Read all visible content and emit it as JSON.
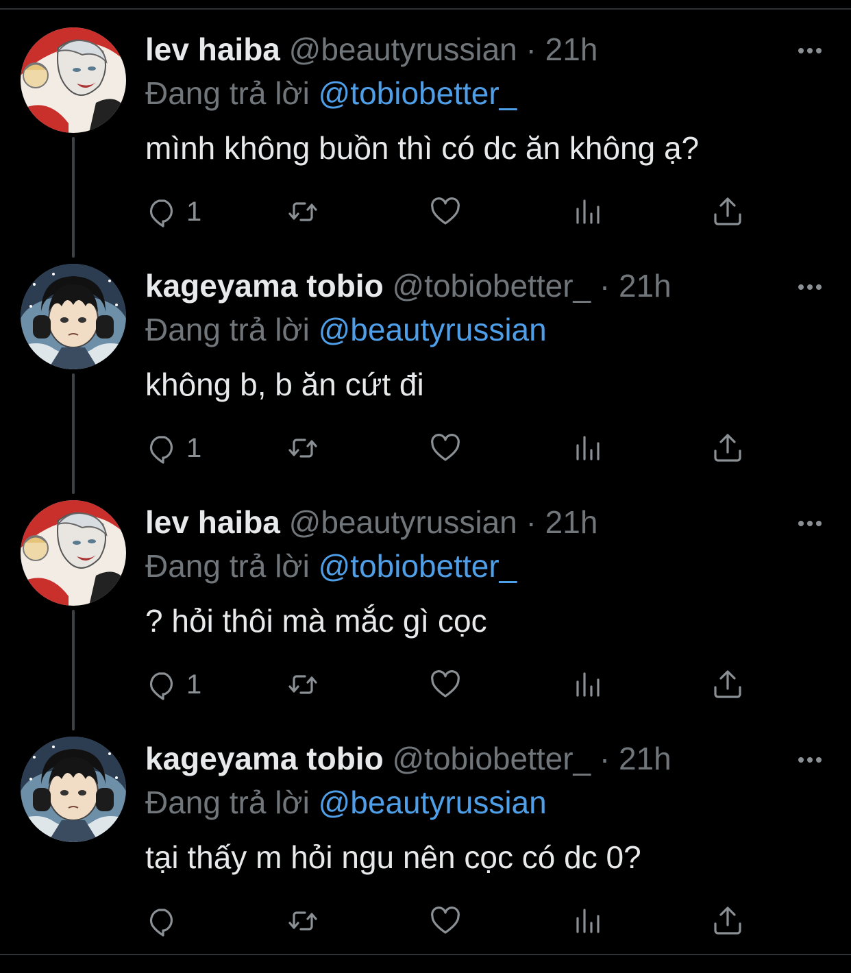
{
  "tweets": [
    {
      "display_name": "lev haiba",
      "handle": "@beautyrussian",
      "separator": "·",
      "time": "21h",
      "replying_prefix": "Đang trả lời",
      "replying_to": "@tobiobetter_",
      "text": "mình không buồn thì có dc ăn không ạ?",
      "reply_count": "1",
      "avatar": "lev-avatar"
    },
    {
      "display_name": "kageyama tobio",
      "handle": "@tobiobetter_",
      "separator": "·",
      "time": "21h",
      "replying_prefix": "Đang trả lời",
      "replying_to": "@beautyrussian",
      "text": "không b, b ăn cứt đi",
      "reply_count": "1",
      "avatar": "kageyama-avatar"
    },
    {
      "display_name": "lev haiba",
      "handle": "@beautyrussian",
      "separator": "·",
      "time": "21h",
      "replying_prefix": "Đang trả lời",
      "replying_to": "@tobiobetter_",
      "text": "? hỏi thôi mà mắc gì cọc",
      "reply_count": "1",
      "avatar": "lev-avatar"
    },
    {
      "display_name": "kageyama tobio",
      "handle": "@tobiobetter_",
      "separator": "·",
      "time": "21h",
      "replying_prefix": "Đang trả lời",
      "replying_to": "@beautyrussian",
      "text": "tại thấy m hỏi ngu nên cọc có dc 0?",
      "reply_count": "",
      "avatar": "kageyama-avatar"
    }
  ],
  "icons": {
    "reply": "reply-icon",
    "retweet": "retweet-icon",
    "like": "heart-icon",
    "analytics": "analytics-icon",
    "share": "share-icon",
    "more": "more-icon"
  },
  "colors": {
    "background": "#000000",
    "primary_text": "#e7e9ea",
    "secondary_text": "#71767b",
    "mention": "#4f9fe8",
    "thread_line": "#3e4144"
  }
}
